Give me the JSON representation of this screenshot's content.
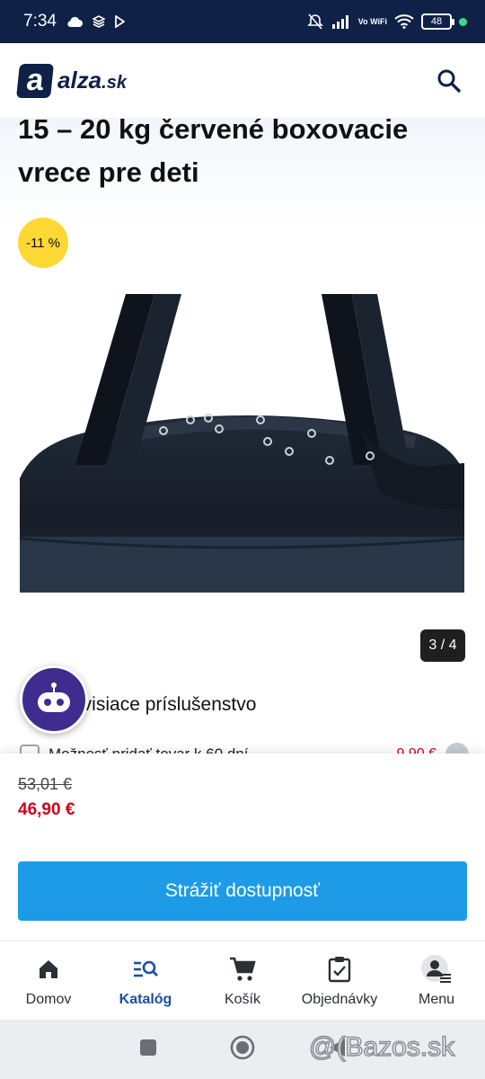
{
  "status_bar": {
    "time": "7:34",
    "network": "Vo WiFi",
    "battery": "48"
  },
  "header": {
    "logo_mark": "a",
    "logo_name": "alza",
    "logo_tld": ".sk"
  },
  "product": {
    "title": "15 – 20 kg červené boxovacie vrece pre deti",
    "discount_badge": "-11 %",
    "image_counter": "3 / 4",
    "accessories_title": "Súvisiace príslušenstvo",
    "accessory_item_label": "Možnosť pridať tovar k 60 dní",
    "accessory_item_price": "9,90 €"
  },
  "pricing": {
    "old_price": "53,01 €",
    "new_price": "46,90 €",
    "watch_button": "Strážiť dostupnosť"
  },
  "bottom_nav": {
    "items": [
      {
        "label": "Domov"
      },
      {
        "label": "Katalóg"
      },
      {
        "label": "Košík"
      },
      {
        "label": "Objednávky"
      },
      {
        "label": "Menu"
      }
    ],
    "active_index": 1
  },
  "watermark": "@(Bazos.sk",
  "colors": {
    "brand_navy": "#0f2147",
    "accent_blue": "#1e9be6",
    "active_nav": "#1a4fa3",
    "price_red": "#d0021b",
    "badge_yellow": "#fdd835"
  }
}
